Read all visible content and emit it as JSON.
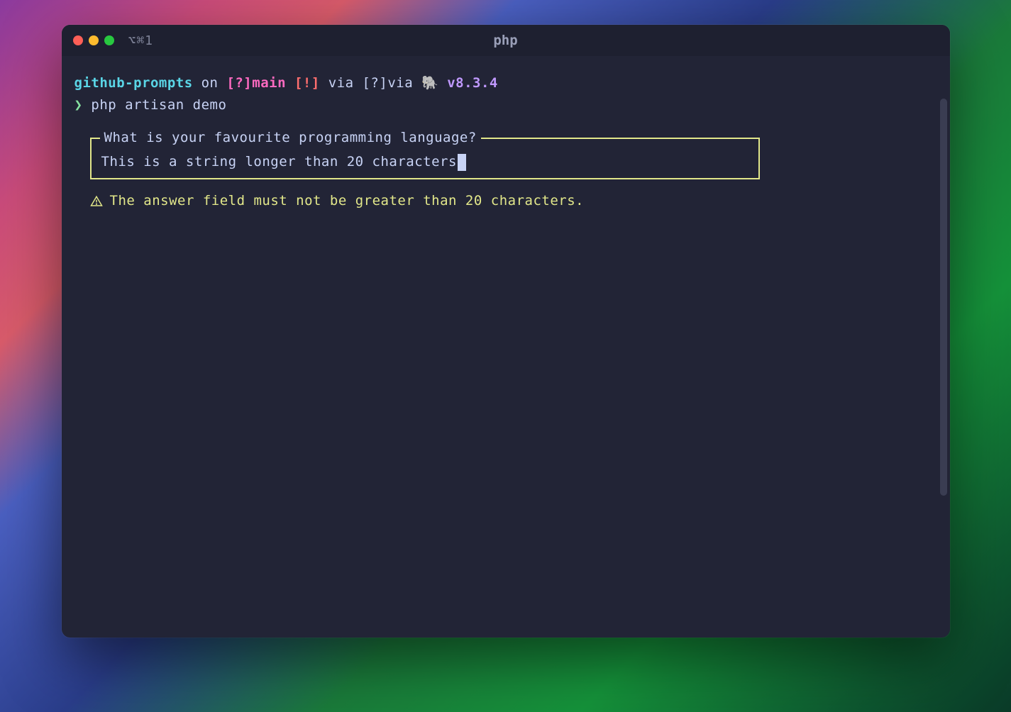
{
  "window": {
    "title": "php",
    "tab_indicator": "⌥⌘1"
  },
  "prompt": {
    "directory": "github-prompts",
    "on_text": " on ",
    "branch_open": "[?]",
    "branch": "main",
    "branch_status": " [!]",
    "via_text1": " via ",
    "via_icon": "[?]",
    "via_text2": "via ",
    "elephant_icon": "🐘",
    "version": " v8.3.4",
    "chevron": "❯",
    "command": " php artisan demo"
  },
  "input_prompt": {
    "question": " What is your favourite programming language? ",
    "answer": "This is a string longer than 20 characters"
  },
  "error": {
    "message": "The answer field must not be greater than 20 characters."
  }
}
